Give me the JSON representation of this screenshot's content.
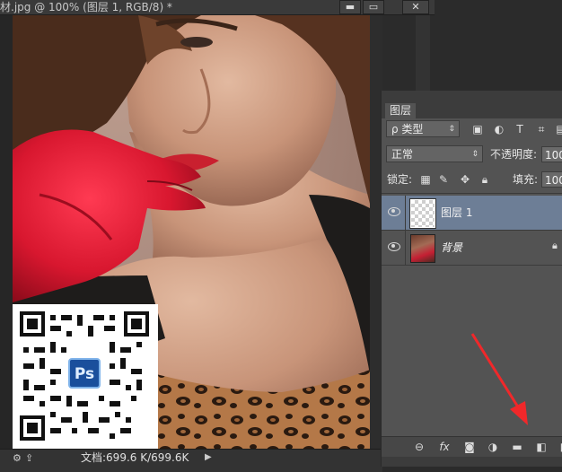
{
  "document": {
    "title": "材.jpg @ 100% (图层 1, RGB/8) *",
    "window_buttons": {
      "minimize": "▬",
      "restore": "▭",
      "close": "✕"
    },
    "status_size": "文档:699.6 K/699.6K",
    "status_arrow": "▶"
  },
  "layers_panel": {
    "tab_label": "图层",
    "filter": {
      "label": "ρ 类型",
      "icons": [
        "image-icon",
        "adjustment-icon",
        "type-icon",
        "shape-icon",
        "smart-object-icon"
      ]
    },
    "blend_mode": "正常",
    "opacity_label": "不透明度:",
    "opacity_value": "100",
    "lock_label": "锁定:",
    "fill_label": "填充:",
    "fill_value": "100",
    "layers": [
      {
        "name": "图层 1",
        "selected": true,
        "thumb": "transparent"
      },
      {
        "name": "背景",
        "selected": false,
        "thumb": "photo",
        "locked": true
      }
    ],
    "bottom_icons": [
      "link-icon",
      "fx-icon",
      "mask-icon",
      "adjustment-layer-icon",
      "group-folder-icon",
      "new-layer-icon",
      "delete-icon"
    ],
    "fx_label": "fx"
  },
  "overlay": {
    "ps_badge": "Ps",
    "arrow_color": "#f0282a"
  }
}
